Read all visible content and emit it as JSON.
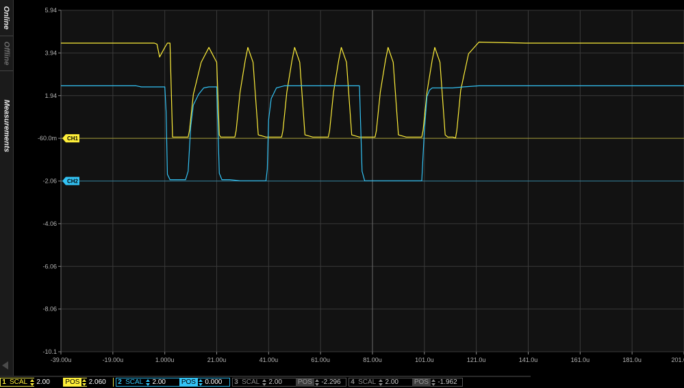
{
  "sidebar": {
    "tabs": [
      {
        "label": "Online",
        "active": true
      },
      {
        "label": "Offline",
        "active": false
      },
      {
        "label": "Measurements",
        "active": false
      }
    ]
  },
  "scope": {
    "background": "#121212",
    "grid_color": "#3a3a3a",
    "y_ticks": [
      "5.94",
      "3.94",
      "1.94",
      "-60.0m",
      "-2.06",
      "-4.06",
      "-6.06",
      "-8.06",
      "-10.1"
    ],
    "x_ticks": [
      "-39.00u",
      "-19.00u",
      "1.000u",
      "21.00u",
      "41.00u",
      "61.00u",
      "81.00u",
      "101.0u",
      "121.0u",
      "141.0u",
      "161.0u",
      "181.0u",
      "201.0u"
    ],
    "markers": [
      {
        "label": "CH1",
        "color": "#ffef3a",
        "level": -0.06
      },
      {
        "label": "CH2",
        "color": "#33c3f5",
        "level": -2.06
      }
    ]
  },
  "chart_data": {
    "type": "line",
    "title": "",
    "xlabel": "",
    "ylabel": "",
    "xlim": [
      -39,
      201
    ],
    "ylim": [
      -10.06,
      5.94
    ],
    "grid": true,
    "series": [
      {
        "name": "CH1",
        "color": "#ffef3a",
        "x": [
          -39,
          -3,
          -2,
          -1,
          1,
          2,
          3,
          4,
          10,
          10.5,
          12,
          15,
          18,
          21,
          22,
          22.5,
          23,
          28,
          28.5,
          30,
          32,
          33,
          35,
          37,
          40,
          40.5,
          41,
          46,
          46.5,
          48,
          50,
          51,
          53,
          55,
          58,
          58.5,
          59,
          64,
          64.5,
          66,
          68,
          69,
          71,
          73,
          76,
          76.5,
          77,
          82,
          82.5,
          84,
          86,
          87,
          89,
          91,
          94,
          94.5,
          95,
          100,
          100.5,
          102,
          104,
          105,
          107,
          109,
          110,
          112,
          113,
          113.5,
          115,
          118,
          122,
          140,
          201
        ],
        "values": [
          4.4,
          4.4,
          4.35,
          3.75,
          4.2,
          4.4,
          4.4,
          0,
          0,
          0.3,
          2.0,
          3.5,
          4.2,
          3.5,
          0.1,
          0,
          0,
          0,
          0.3,
          2.1,
          3.6,
          4.2,
          3.5,
          0.1,
          0,
          0,
          0,
          0,
          0.3,
          2.1,
          3.6,
          4.2,
          3.5,
          0.1,
          0,
          0,
          0,
          0,
          0.3,
          2.1,
          3.6,
          4.2,
          3.5,
          0.1,
          0,
          0,
          0,
          0,
          0.3,
          2.1,
          3.6,
          4.2,
          3.5,
          0.1,
          0,
          0,
          0,
          0,
          0.3,
          2.1,
          3.6,
          4.2,
          3.5,
          0.1,
          0,
          0,
          -0.05,
          0.3,
          2.2,
          3.9,
          4.45,
          4.4,
          4.4
        ]
      },
      {
        "name": "CH2",
        "color": "#33c3f5",
        "x": [
          -39,
          -10,
          -8,
          1,
          1.5,
          2,
          3,
          4,
          7,
          9,
          10,
          11,
          12,
          14,
          16,
          18,
          21,
          22,
          23,
          24,
          26,
          30,
          32,
          35,
          38,
          40,
          40.5,
          41,
          42,
          44,
          47,
          50,
          60,
          70,
          75,
          76,
          77,
          78,
          80,
          82,
          86,
          90,
          92,
          94,
          96,
          100,
          101,
          102,
          103,
          104,
          106,
          108,
          110,
          112,
          116,
          122,
          150,
          201
        ],
        "values": [
          2.4,
          2.4,
          2.35,
          2.35,
          1.2,
          -1.75,
          -2.0,
          -2.0,
          -2.0,
          -2.0,
          -1.6,
          0.5,
          1.5,
          2.0,
          2.3,
          2.35,
          2.35,
          -1.7,
          -2.0,
          -2.0,
          -2.0,
          -2.05,
          -2.05,
          -2.05,
          -2.05,
          -2.05,
          -1.5,
          0.8,
          1.8,
          2.3,
          2.4,
          2.4,
          2.4,
          2.4,
          2.4,
          2.4,
          -1.6,
          -2.05,
          -2.05,
          -2.05,
          -2.05,
          -2.05,
          -2.05,
          -2.05,
          -2.05,
          -2.05,
          0.3,
          1.9,
          2.2,
          2.3,
          2.3,
          2.3,
          2.3,
          2.3,
          2.35,
          2.4,
          2.4,
          2.4
        ]
      }
    ]
  },
  "status": {
    "ch1": {
      "num": "1",
      "scal_label": "SCAL",
      "scal_value": "2.00",
      "pos_label": "POS",
      "pos_value": "2.060"
    },
    "ch2": {
      "num": "2",
      "scal_label": "SCAL",
      "scal_value": "2.00",
      "pos_label": "POS",
      "pos_value": "0.000"
    },
    "ch3": {
      "num": "3",
      "scal_label": "SCAL",
      "scal_value": "2.00",
      "pos_label": "POS",
      "pos_value": "-2.296"
    },
    "ch4": {
      "num": "4",
      "scal_label": "SCAL",
      "scal_value": "2.00",
      "pos_label": "POS",
      "pos_value": "-1.962"
    }
  }
}
